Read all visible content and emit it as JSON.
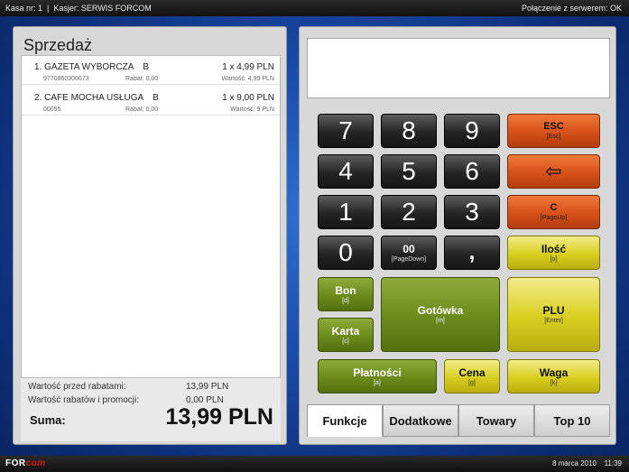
{
  "topbar": {
    "kasa": "Kasa nr: 1",
    "separator": "|",
    "kasjer": "Kasjer: SERWIS FORCOM",
    "connection": "Połączenie z serwerem: OK"
  },
  "bottombar": {
    "logo_part1": "FOR",
    "logo_part2": "com",
    "date": "8 marca 2010",
    "time": "11:39"
  },
  "sale": {
    "title": "Sprzedaż",
    "items": [
      {
        "index_name": "1. GAZETA WYBORCZA",
        "vat": "B",
        "qty_price": "1 x 4,99 PLN",
        "code": "9770860900673",
        "rabat": "Rabat: 0,00",
        "wartosc": "Wartość: 4,99 PLN"
      },
      {
        "index_name": "2. CAFE MOCHA USŁUGA",
        "vat": "B",
        "qty_price": "1 x 9,00 PLN",
        "code": "00055",
        "rabat": "Rabat: 0,00",
        "wartosc": "Wartość: 9 PLN"
      }
    ],
    "summary": {
      "before_label": "Wartość przed rabatami:",
      "before_value": "13,99 PLN",
      "rabats_label": "Wartość rabatów i promocji:",
      "rabats_value": "0,00 PLN",
      "suma_label": "Suma:",
      "suma_value": "13,99 PLN"
    }
  },
  "display": {
    "text": ""
  },
  "keypad": {
    "k7": "7",
    "k8": "8",
    "k9": "9",
    "k4": "4",
    "k5": "5",
    "k6": "6",
    "k1": "1",
    "k2": "2",
    "k3": "3",
    "k0": "0",
    "k00": "00",
    "k00_sub": "[PageDown]",
    "comma": ",",
    "esc": "ESC",
    "esc_sub": "[Esc]",
    "backspace": "⇦",
    "c": "C",
    "c_sub": "[PageUp]",
    "ilosc": "Ilość",
    "ilosc_sub": "[o]",
    "bon": "Bon",
    "bon_sub": "[d]",
    "karta": "Karta",
    "karta_sub": "[c]",
    "gotowka": "Gotówka",
    "gotowka_sub": "[m]",
    "plu": "PLU",
    "plu_sub": "[Enter]",
    "platnosci": "Płatności",
    "platnosci_sub": "[a]",
    "cena": "Cena",
    "cena_sub": "[g]",
    "waga": "Waga",
    "waga_sub": "[k]"
  },
  "tabs": [
    "Funkcje",
    "Dodatkowe",
    "Towary",
    "Top 10"
  ],
  "colors": {
    "background": "#1b4fae",
    "key_dark": "#242424",
    "key_orange": "#d5501a",
    "key_yellow": "#d8ce20",
    "key_green": "#6b8a1c"
  }
}
